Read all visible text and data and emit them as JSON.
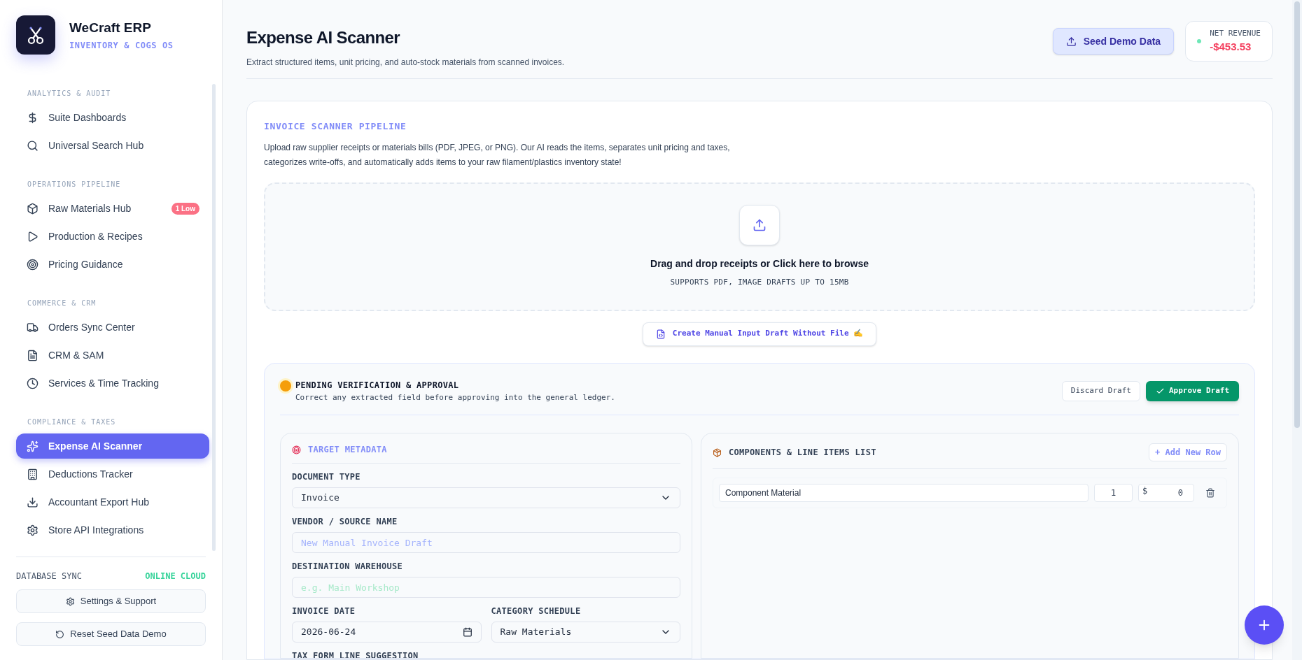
{
  "brand": {
    "name": "WeCraft ERP",
    "tagline": "INVENTORY & COGS OS"
  },
  "sidebar": {
    "sections": [
      {
        "title": "ANALYTICS & AUDIT",
        "items": [
          {
            "label": "Suite Dashboards",
            "selected": false
          },
          {
            "label": "Universal Search Hub",
            "selected": false
          }
        ]
      },
      {
        "title": "OPERATIONS PIPELINE",
        "items": [
          {
            "label": "Raw Materials Hub",
            "selected": false,
            "badge": "1 Low"
          },
          {
            "label": "Production & Recipes",
            "selected": false
          },
          {
            "label": "Pricing Guidance",
            "selected": false
          }
        ]
      },
      {
        "title": "COMMERCE & CRM",
        "items": [
          {
            "label": "Orders Sync Center",
            "selected": false
          },
          {
            "label": "CRM & SAM",
            "selected": false
          },
          {
            "label": "Services & Time Tracking",
            "selected": false
          }
        ]
      },
      {
        "title": "COMPLIANCE & TAXES",
        "items": [
          {
            "label": "Expense AI Scanner",
            "selected": true
          },
          {
            "label": "Deductions Tracker",
            "selected": false
          },
          {
            "label": "Accountant Export Hub",
            "selected": false
          },
          {
            "label": "Store API Integrations",
            "selected": false
          }
        ]
      }
    ],
    "db_sync": {
      "label": "DATABASE SYNC",
      "status": "ONLINE CLOUD"
    },
    "buttons": [
      "Settings & Support",
      "Reset Seed Data Demo"
    ]
  },
  "header": {
    "title": "Expense AI Scanner",
    "subtitle": "Extract structured items, unit pricing, and auto-stock materials from scanned invoices.",
    "seed_button": "Seed Demo Data",
    "revenue": {
      "label": "NET REVENUE",
      "value": "-$453.53"
    }
  },
  "pipeline": {
    "title": "INVOICE SCANNER PIPELINE",
    "description": "Upload raw supplier receipts or materials bills (PDF, JPEG, or PNG). Our AI reads the items, separates unit pricing and taxes, categorizes write-offs, and automatically adds items to your raw filament/plastics inventory state!",
    "dropzone": {
      "title": "Drag and drop receipts or Click here to browse",
      "hint": "SUPPORTS PDF, IMAGE DRAFTS UP TO 15MB"
    },
    "manual_button": "Create Manual Input Draft Without File ✍️"
  },
  "pending": {
    "title": "PENDING VERIFICATION & APPROVAL",
    "subtitle": "Correct any extracted field before approving into the general ledger.",
    "discard": "Discard Draft",
    "approve": "Approve Draft",
    "metadata": {
      "title": "TARGET METADATA",
      "fields": [
        {
          "label": "DOCUMENT TYPE",
          "kind": "select",
          "value": "Invoice"
        },
        {
          "label": "VENDOR / SOURCE NAME",
          "kind": "text",
          "placeholder": "New Manual Invoice Draft"
        },
        {
          "label": "DESTINATION WAREHOUSE",
          "kind": "text",
          "placeholder": "e.g. Main Workshop"
        }
      ],
      "row": [
        {
          "label": "INVOICE DATE",
          "kind": "date",
          "value": "2026-06-24"
        },
        {
          "label": "CATEGORY SCHEDULE",
          "kind": "select",
          "value": "Raw Materials"
        }
      ],
      "next_label": "TAX FORM LINE SUGGESTION"
    },
    "items": {
      "title": "COMPONENTS & LINE ITEMS LIST",
      "add_button": "+ Add New Row",
      "rows": [
        {
          "name": "Component Material",
          "qty": "1",
          "currency": "$",
          "price": "0"
        }
      ]
    }
  }
}
